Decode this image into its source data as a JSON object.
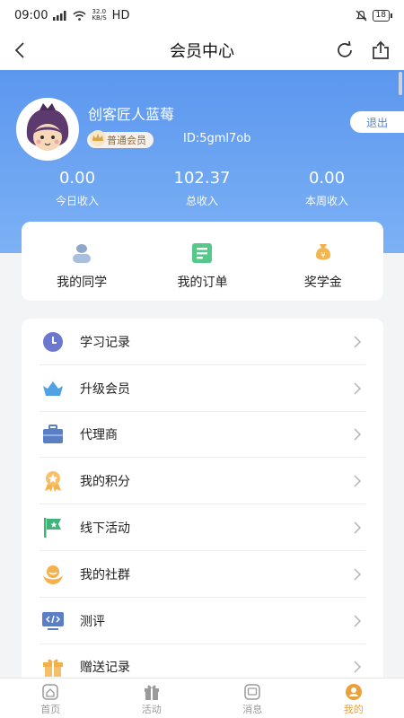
{
  "status_bar": {
    "time": "09:00",
    "net_speed_value": "32.0",
    "net_speed_unit": "KB/S",
    "network": "HD",
    "battery": "18"
  },
  "nav": {
    "title": "会员中心"
  },
  "profile": {
    "name": "创客匠人蓝莓",
    "level": "普通会员",
    "id": "ID:5gml7ob",
    "logout": "退出",
    "stats": [
      {
        "value": "0.00",
        "label": "今日收入"
      },
      {
        "value": "102.37",
        "label": "总收入"
      },
      {
        "value": "0.00",
        "label": "本周收入"
      }
    ]
  },
  "quick_actions": [
    {
      "label": "我的同学",
      "icon": "classmates-icon"
    },
    {
      "label": "我的订单",
      "icon": "orders-icon"
    },
    {
      "label": "奖学金",
      "icon": "scholarship-icon"
    }
  ],
  "menu": [
    {
      "label": "学习记录",
      "icon": "clock-icon"
    },
    {
      "label": "升级会员",
      "icon": "crown-icon"
    },
    {
      "label": "代理商",
      "icon": "briefcase-icon"
    },
    {
      "label": "我的积分",
      "icon": "points-medal-icon"
    },
    {
      "label": "线下活动",
      "icon": "flag-icon"
    },
    {
      "label": "我的社群",
      "icon": "community-icon"
    },
    {
      "label": "测评",
      "icon": "code-monitor-icon"
    },
    {
      "label": "赠送记录",
      "icon": "gift-icon"
    }
  ],
  "tabs": [
    {
      "label": "首页",
      "icon": "home-icon"
    },
    {
      "label": "活动",
      "icon": "activity-gift-icon"
    },
    {
      "label": "消息",
      "icon": "message-icon"
    },
    {
      "label": "我的",
      "icon": "profile-icon",
      "active": true
    }
  ],
  "colors": {
    "primary": "#5c97ef",
    "accent": "#e9a23b",
    "badge_text": "#8d6a3b"
  }
}
